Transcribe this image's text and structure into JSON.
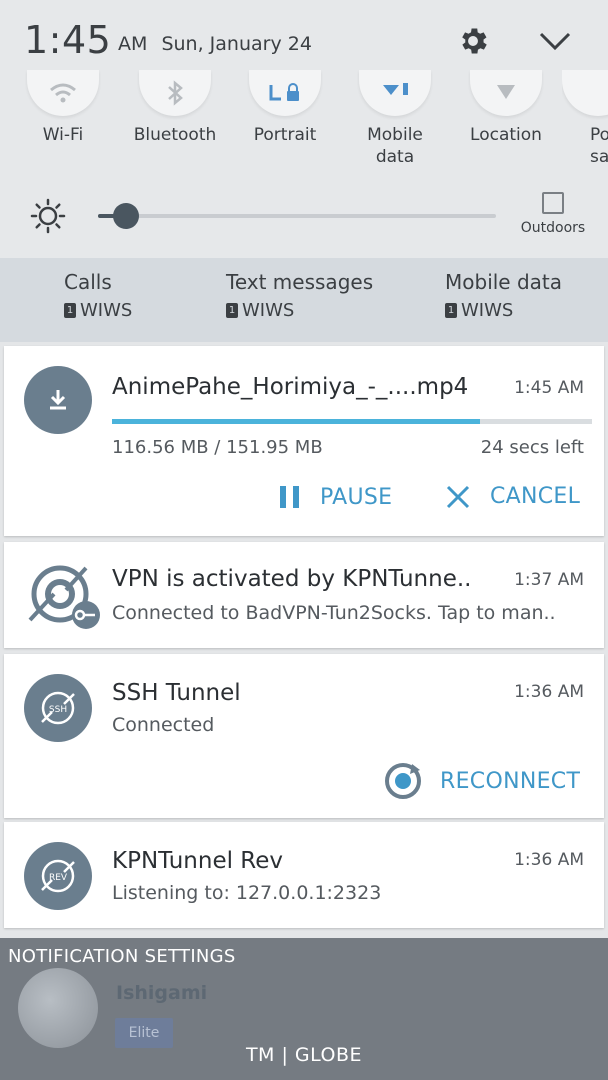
{
  "status": {
    "time": "1:45",
    "ampm": "AM",
    "date": "Sun, January 24"
  },
  "quick_toggles": [
    {
      "label": "Wi-Fi",
      "icon": "wifi-icon",
      "active": false
    },
    {
      "label": "Bluetooth",
      "icon": "bluetooth-icon",
      "active": false
    },
    {
      "label": "Portrait",
      "icon": "portrait-lock-icon",
      "active": true
    },
    {
      "label": "Mobile\ndata",
      "icon": "mobile-data-icon",
      "active": true
    },
    {
      "label": "Location",
      "icon": "location-icon",
      "active": false
    },
    {
      "label": "Po\nsa",
      "icon": "power-saving-icon",
      "active": false
    }
  ],
  "brightness": {
    "level": 0.07,
    "outdoors_label": "Outdoors"
  },
  "sim": [
    {
      "title": "Calls",
      "sim": "WIWS"
    },
    {
      "title": "Text messages",
      "sim": "WIWS"
    },
    {
      "title": "Mobile data",
      "sim": "WIWS"
    }
  ],
  "notifications": {
    "download": {
      "title": "AnimePahe_Horimiya_-_....mp4",
      "time": "1:45 AM",
      "progress": 0.7677,
      "size_text": "116.56 MB / 151.95 MB",
      "remaining": "24 secs left",
      "pause_label": "PAUSE",
      "cancel_label": "CANCEL"
    },
    "vpn": {
      "title": "VPN is activated by KPNTunne..",
      "time": "1:37 AM",
      "subtitle": "Connected to BadVPN-Tun2Socks. Tap to man.."
    },
    "ssh": {
      "title": "SSH Tunnel",
      "time": "1:36 AM",
      "subtitle": "Connected",
      "icon_text": "SSH",
      "reconnect_label": "RECONNECT"
    },
    "kpn": {
      "title": "KPNTunnel Rev",
      "time": "1:36 AM",
      "subtitle": "Listening to: 127.0.0.1:2323",
      "icon_text": "REV"
    }
  },
  "notification_settings_label": "NOTIFICATION SETTINGS",
  "background": {
    "user_name": "Ishigami",
    "badge": "Elite"
  },
  "carrier": "TM | GLOBE",
  "colors": {
    "accent": "#3f97c8",
    "progress": "#4bb3db",
    "icon_bg": "#6a7e8e"
  }
}
